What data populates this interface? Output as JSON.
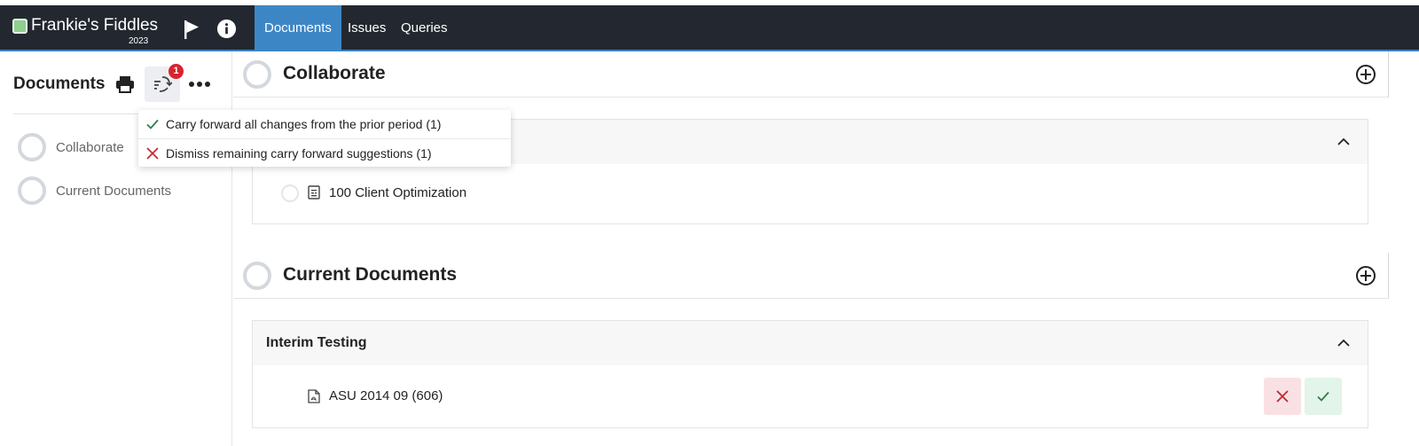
{
  "app": {
    "name": "Frankie's Fiddles",
    "year": "2023",
    "brand_color": "#8fcf8f"
  },
  "nav": {
    "tabs": [
      {
        "label": "Documents",
        "active": true
      },
      {
        "label": "Issues",
        "active": false
      },
      {
        "label": "Queries",
        "active": false
      }
    ],
    "icons": [
      "flag-icon",
      "info-icon"
    ]
  },
  "sidebar": {
    "title": "Documents",
    "toolbar": {
      "print_icon": "printer-icon",
      "carry_forward_icon": "carry-forward-icon",
      "more_icon": "more-icon",
      "badge_count": "1"
    },
    "items": [
      {
        "label": "Collaborate"
      },
      {
        "label": "Current Documents"
      }
    ]
  },
  "popup": {
    "items": [
      {
        "label": "Carry forward all changes from the prior period (1)",
        "icon": "check-icon",
        "color": "#2e7d4a"
      },
      {
        "label": "Dismiss remaining carry forward suggestions (1)",
        "icon": "close-icon",
        "color": "#c6262e"
      }
    ]
  },
  "sections": [
    {
      "title": "Collaborate",
      "card": {
        "title": "",
        "docs": [
          {
            "name": "100 Client Optimization",
            "icon": "form-doc-icon"
          }
        ]
      }
    },
    {
      "title": "Current Documents",
      "card": {
        "title": "Interim Testing",
        "docs": [
          {
            "name": "ASU 2014 09 (606)",
            "icon": "pdf-doc-icon"
          }
        ]
      }
    }
  ],
  "colors": {
    "topbar": "#232830",
    "active_tab": "#3d86c6",
    "badge": "#d9232e",
    "reject_bg": "#f9e1e3",
    "accept_bg": "#e3f4ea"
  }
}
